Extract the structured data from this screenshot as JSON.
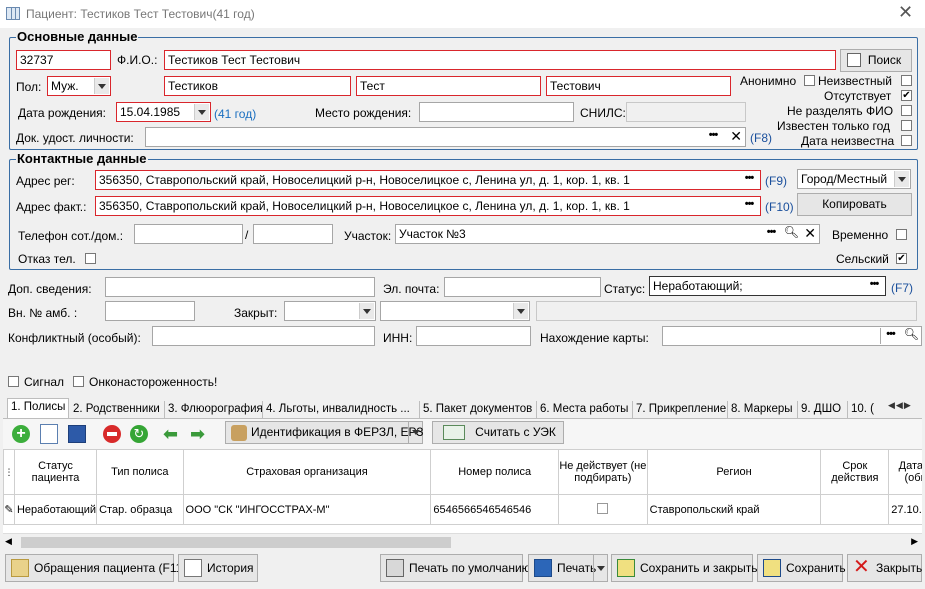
{
  "window": {
    "title": "Пациент: Тестиков Тест Тестович(41 год)"
  },
  "basic": {
    "title": "Основные данные",
    "id_value": "32737",
    "fio_label": "Ф.И.О.:",
    "fio_value": "Тестиков Тест Тестович",
    "search_button": "Поиск",
    "sex_label": "Пол:",
    "sex_value": "Муж.",
    "last_name": "Тестиков",
    "first_name": "Тест",
    "middle_name": "Тестович",
    "birth_label": "Дата рождения:",
    "birth_value": "15.04.1985",
    "age": "(41 год)",
    "birthplace_label": "Место рождения:",
    "birthplace_value": "",
    "snils_label": "СНИЛС:",
    "snils_value": "",
    "doc_label": "Док. удост. личности:",
    "doc_value": "",
    "doc_hotkey": "(F8)",
    "flags": [
      {
        "left": "Анонимно",
        "right": "Неизвестный",
        "checked": false
      },
      {
        "left": "",
        "right": "Отсутствует",
        "checked": true
      },
      {
        "left": "",
        "right": "Не разделять ФИО",
        "checked": false
      },
      {
        "left": "",
        "right": "Известен только год",
        "checked": false
      },
      {
        "left": "",
        "right": "Дата неизвестна",
        "checked": false
      }
    ]
  },
  "contacts": {
    "title": "Контактные данные",
    "reg_label": "Адрес рег:",
    "reg_value": "356350, Ставропольский край, Новоселицкий р-н, Новоселицкое с, Ленина ул, д. 1, кор. 1, кв. 1",
    "reg_hotkey": "(F9)",
    "locality_type": "Город/Местный",
    "fact_label": "Адрес факт.:",
    "fact_value": "356350, Ставропольский край, Новоселицкий р-н, Новоселицкое с, Ленина ул, д. 1, кор. 1, кв. 1",
    "fact_hotkey": "(F10)",
    "copy_button": "Копировать",
    "phone_label": "Телефон сот./дом.:",
    "phone_sep": "/",
    "area_label": "Участок:",
    "area_value": "Участок №3",
    "temporary_label": "Временно",
    "phone_refusal_label": "Отказ тел.",
    "rural_label": "Сельский",
    "rural_checked": true
  },
  "extra": {
    "add_info_label": "Доп. сведения:",
    "email_label": "Эл. почта:",
    "status_label": "Статус:",
    "status_value": "Неработающий;",
    "status_hotkey": "(F7)",
    "amb_label": "Вн. № амб. :",
    "closed_label": "Закрыт:",
    "conflict_label": "Конфликтный (особый):",
    "inn_label": "ИНН:",
    "card_label": "Нахождение карты:",
    "signal_label": "Сигнал",
    "onco_label": "Онконастороженность!"
  },
  "tabs": [
    "1. Полисы",
    "2. Родственники",
    "3. Флюорография",
    "4. Льготы, инвалидность ...",
    "5. Пакет документов",
    "6. Места работы",
    "7. Прикрепление",
    "8. Маркеры",
    "9. ДШО",
    "10. ("
  ],
  "toolbar": {
    "identify": "Идентификация в ФЕРЗЛ, ЕРЗ",
    "read_card": "Считать с УЭК"
  },
  "grid": {
    "headers": [
      "Статус пациента",
      "Тип полиса",
      "Страховая организация",
      "Номер полиса",
      "Не действует (не подбирать)",
      "Регион",
      "Срок действия",
      "Дата д (обн"
    ],
    "rows": [
      {
        "status": "Неработающий",
        "type": "Стар. образца",
        "org": "ООО \"СК \"ИНГОССТРАХ-М\"",
        "number": "6546566546546546",
        "region": "Ставропольский край",
        "date": "27.10."
      }
    ]
  },
  "bottom": {
    "visits": "Обращения пациента (F11)",
    "history": "История",
    "print_default": "Печать по умолчанию",
    "print": "Печать",
    "save_close": "Сохранить и закрыть",
    "save": "Сохранить",
    "close": "Закрыть"
  },
  "colors": {
    "required_border": "#d9262c",
    "group_border": "#3a6ea5",
    "hotkey": "#1a4f9c"
  }
}
